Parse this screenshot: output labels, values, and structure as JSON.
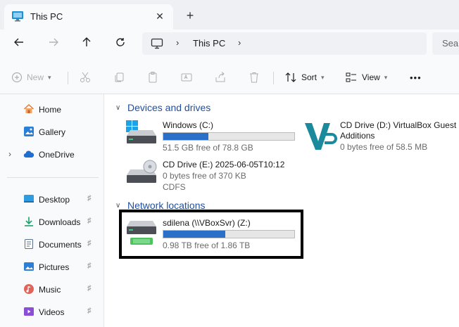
{
  "window": {
    "tab_title": "This PC",
    "close_glyph": "✕",
    "new_tab_glyph": "+"
  },
  "address_bar": {
    "breadcrumb": "This PC",
    "separator": "›",
    "search_placeholder": "Sea"
  },
  "toolbar": {
    "new_label": "New",
    "sort_label": "Sort",
    "view_label": "View",
    "more_label": "•••"
  },
  "sidebar": {
    "items": [
      {
        "label": "Home",
        "icon": "home-icon"
      },
      {
        "label": "Gallery",
        "icon": "gallery-icon"
      },
      {
        "label": "OneDrive",
        "icon": "cloud-icon"
      },
      {
        "label": "Desktop",
        "icon": "desktop-icon"
      },
      {
        "label": "Downloads",
        "icon": "download-icon"
      },
      {
        "label": "Documents",
        "icon": "documents-icon"
      },
      {
        "label": "Pictures",
        "icon": "pictures-icon"
      },
      {
        "label": "Music",
        "icon": "music-icon"
      },
      {
        "label": "Videos",
        "icon": "videos-icon"
      }
    ],
    "pin_glyph": "📌"
  },
  "groups": {
    "devices_title": "Devices and drives",
    "network_title": "Network locations"
  },
  "drives": {
    "windows": {
      "name": "Windows (C:)",
      "free_text": "51.5 GB free of 78.8 GB",
      "used_fraction": 0.346
    },
    "cd_d": {
      "name_line1": "CD Drive (D:) VirtualBox Guest",
      "name_line2": "Additions",
      "free_text": "0 bytes free of 58.5 MB"
    },
    "cd_e": {
      "name": "CD Drive (E:) 2025-06-05T10:12",
      "free_text": "0 bytes free of 370 KB",
      "fs": "CDFS"
    },
    "network_z": {
      "name": "sdilena (\\\\VBoxSvr) (Z:)",
      "free_text": "0.98 TB free of 1.86 TB",
      "used_fraction": 0.473
    }
  },
  "colors": {
    "accent": "#2a70c8",
    "group_heading": "#1f4f9e",
    "highlight_border": "#000000"
  }
}
